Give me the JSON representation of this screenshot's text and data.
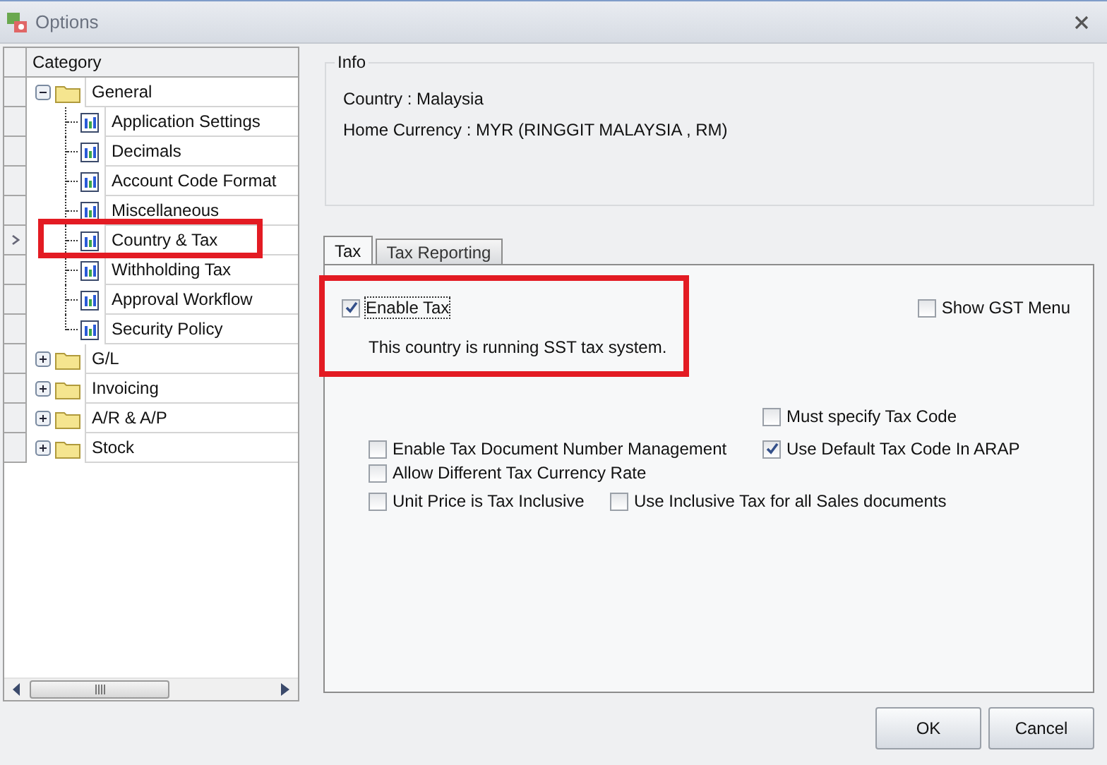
{
  "window": {
    "title": "Options"
  },
  "category_tree": {
    "header": "Category",
    "items": [
      {
        "label": "General",
        "expanded": true,
        "selected": false,
        "children": [
          {
            "label": "Application Settings",
            "selected": false
          },
          {
            "label": "Decimals",
            "selected": false
          },
          {
            "label": "Account Code Format",
            "selected": false
          },
          {
            "label": "Miscellaneous",
            "selected": false
          },
          {
            "label": "Country & Tax",
            "selected": true
          },
          {
            "label": "Withholding Tax",
            "selected": false
          },
          {
            "label": "Approval Workflow",
            "selected": false
          },
          {
            "label": "Security Policy",
            "selected": false
          }
        ]
      },
      {
        "label": "G/L",
        "expanded": false,
        "selected": false
      },
      {
        "label": "Invoicing",
        "expanded": false,
        "selected": false
      },
      {
        "label": "A/R & A/P",
        "expanded": false,
        "selected": false
      },
      {
        "label": "Stock",
        "expanded": false,
        "selected": false
      }
    ]
  },
  "info": {
    "title": "Info",
    "lines": [
      "Country : Malaysia",
      "Home Currency : MYR (RINGGIT MALAYSIA , RM)"
    ]
  },
  "tabs": [
    {
      "label": "Tax",
      "selected": true
    },
    {
      "label": "Tax Reporting",
      "selected": false
    }
  ],
  "tax_tab": {
    "enable_tax": {
      "label": "Enable Tax",
      "checked": true
    },
    "show_gst_menu": {
      "label": "Show GST Menu",
      "checked": false
    },
    "note": "This country is running SST tax system.",
    "options": [
      {
        "label": "Must specify Tax Code",
        "checked": false
      },
      {
        "label": "Enable Tax Document Number Management",
        "checked": false
      },
      {
        "label": "Use Default Tax Code In ARAP",
        "checked": true
      },
      {
        "label": "Allow Different Tax Currency Rate",
        "checked": false
      },
      {
        "label": "Unit Price is Tax Inclusive",
        "checked": false
      },
      {
        "label": "Use Inclusive Tax for all Sales documents",
        "checked": false
      }
    ]
  },
  "buttons": [
    "OK",
    "Cancel"
  ]
}
